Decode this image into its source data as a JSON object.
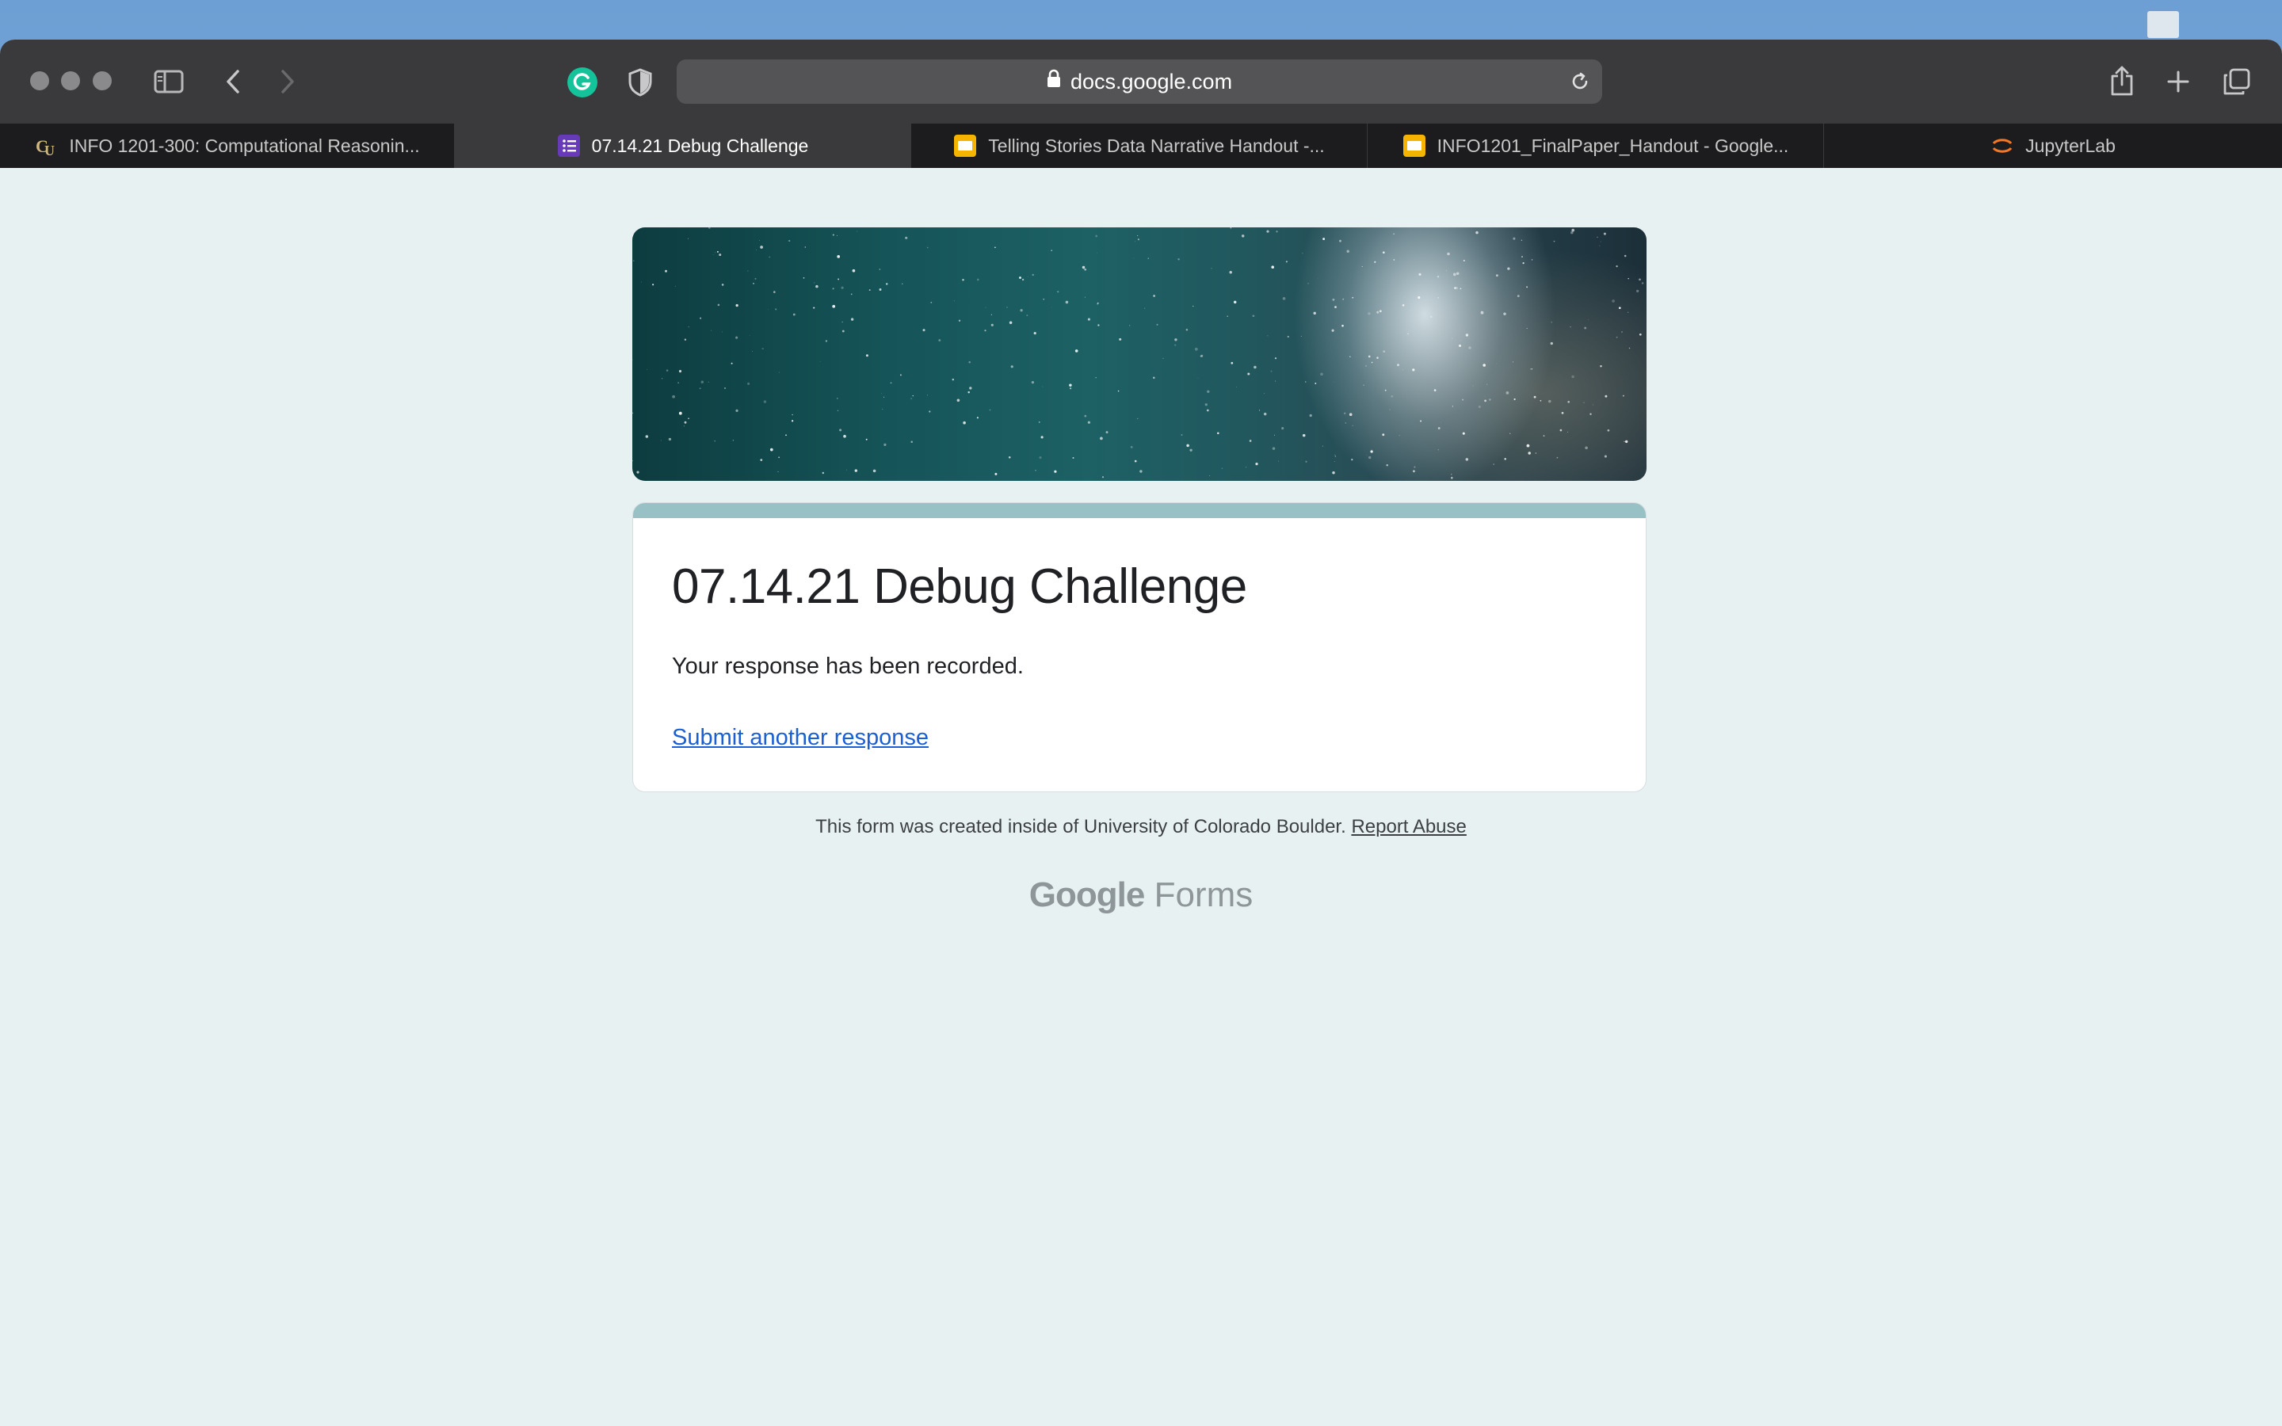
{
  "browser": {
    "url": "docs.google.com",
    "tabs": [
      {
        "label": "INFO 1201-300: Computational Reasonin...",
        "icon": "cu-boulder-icon",
        "active": false
      },
      {
        "label": "07.14.21 Debug Challenge",
        "icon": "google-forms-icon",
        "active": true
      },
      {
        "label": "Telling Stories Data Narrative Handout -...",
        "icon": "google-slides-icon",
        "active": false
      },
      {
        "label": "INFO1201_FinalPaper_Handout - Google...",
        "icon": "google-slides-icon",
        "active": false
      },
      {
        "label": "JupyterLab",
        "icon": "jupyter-icon",
        "active": false
      }
    ],
    "colors": {
      "forms_purple": "#673ab7",
      "slides_yellow": "#f4b400",
      "jupyter_orange": "#f37726"
    }
  },
  "form": {
    "title": "07.14.21 Debug Challenge",
    "message": "Your response has been recorded.",
    "submit_another": "Submit another response",
    "accent_color": "#97c1c4"
  },
  "footer": {
    "created_text": "This form was created inside of University of Colorado Boulder.",
    "report_abuse": "Report Abuse",
    "logo_google": "Google",
    "logo_forms": "Forms"
  }
}
